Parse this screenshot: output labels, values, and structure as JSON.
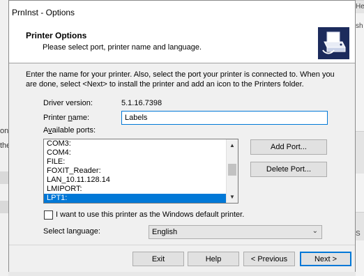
{
  "background": {
    "left_snippets": [
      "on",
      "the"
    ],
    "right_snippets": [
      "Help",
      "sh",
      "S"
    ]
  },
  "dialog": {
    "title": "PrnInst - Options",
    "header_title": "Printer Options",
    "header_subtitle": "Please select port, printer name and language.",
    "header_icon": "printer-icon",
    "intro": "Enter the name for your printer. Also, select the port your printer is connected to. When you are done, select <Next> to install the printer and add an icon to the Printers folder.",
    "driver_version_label": "Driver version:",
    "driver_version_value": "5.1.16.7398",
    "printer_name_label_pre": "Printer ",
    "printer_name_label_u": "n",
    "printer_name_label_post": "ame:",
    "printer_name_value": "Labels",
    "ports_label_pre": "A",
    "ports_label_u": "v",
    "ports_label_post": "ailable ports:",
    "ports": [
      "COM3:",
      "COM4:",
      "FILE:",
      "FOXIT_Reader:",
      "LAN_10.11.128.14",
      "LMIPORT:",
      "LPT1:"
    ],
    "selected_port": "LPT1:",
    "add_port_label": "Add Port...",
    "delete_port_label": "Delete Port...",
    "default_printer_label": "I want to use this printer as the Windows default printer.",
    "default_printer_checked": false,
    "language_label": "Select language:",
    "language_value": "English",
    "buttons": {
      "exit": "Exit",
      "help": "Help",
      "previous": "< Previous",
      "next": "Next >"
    },
    "colors": {
      "accent": "#0078d7",
      "icon_bg": "#1c2b5c"
    }
  }
}
